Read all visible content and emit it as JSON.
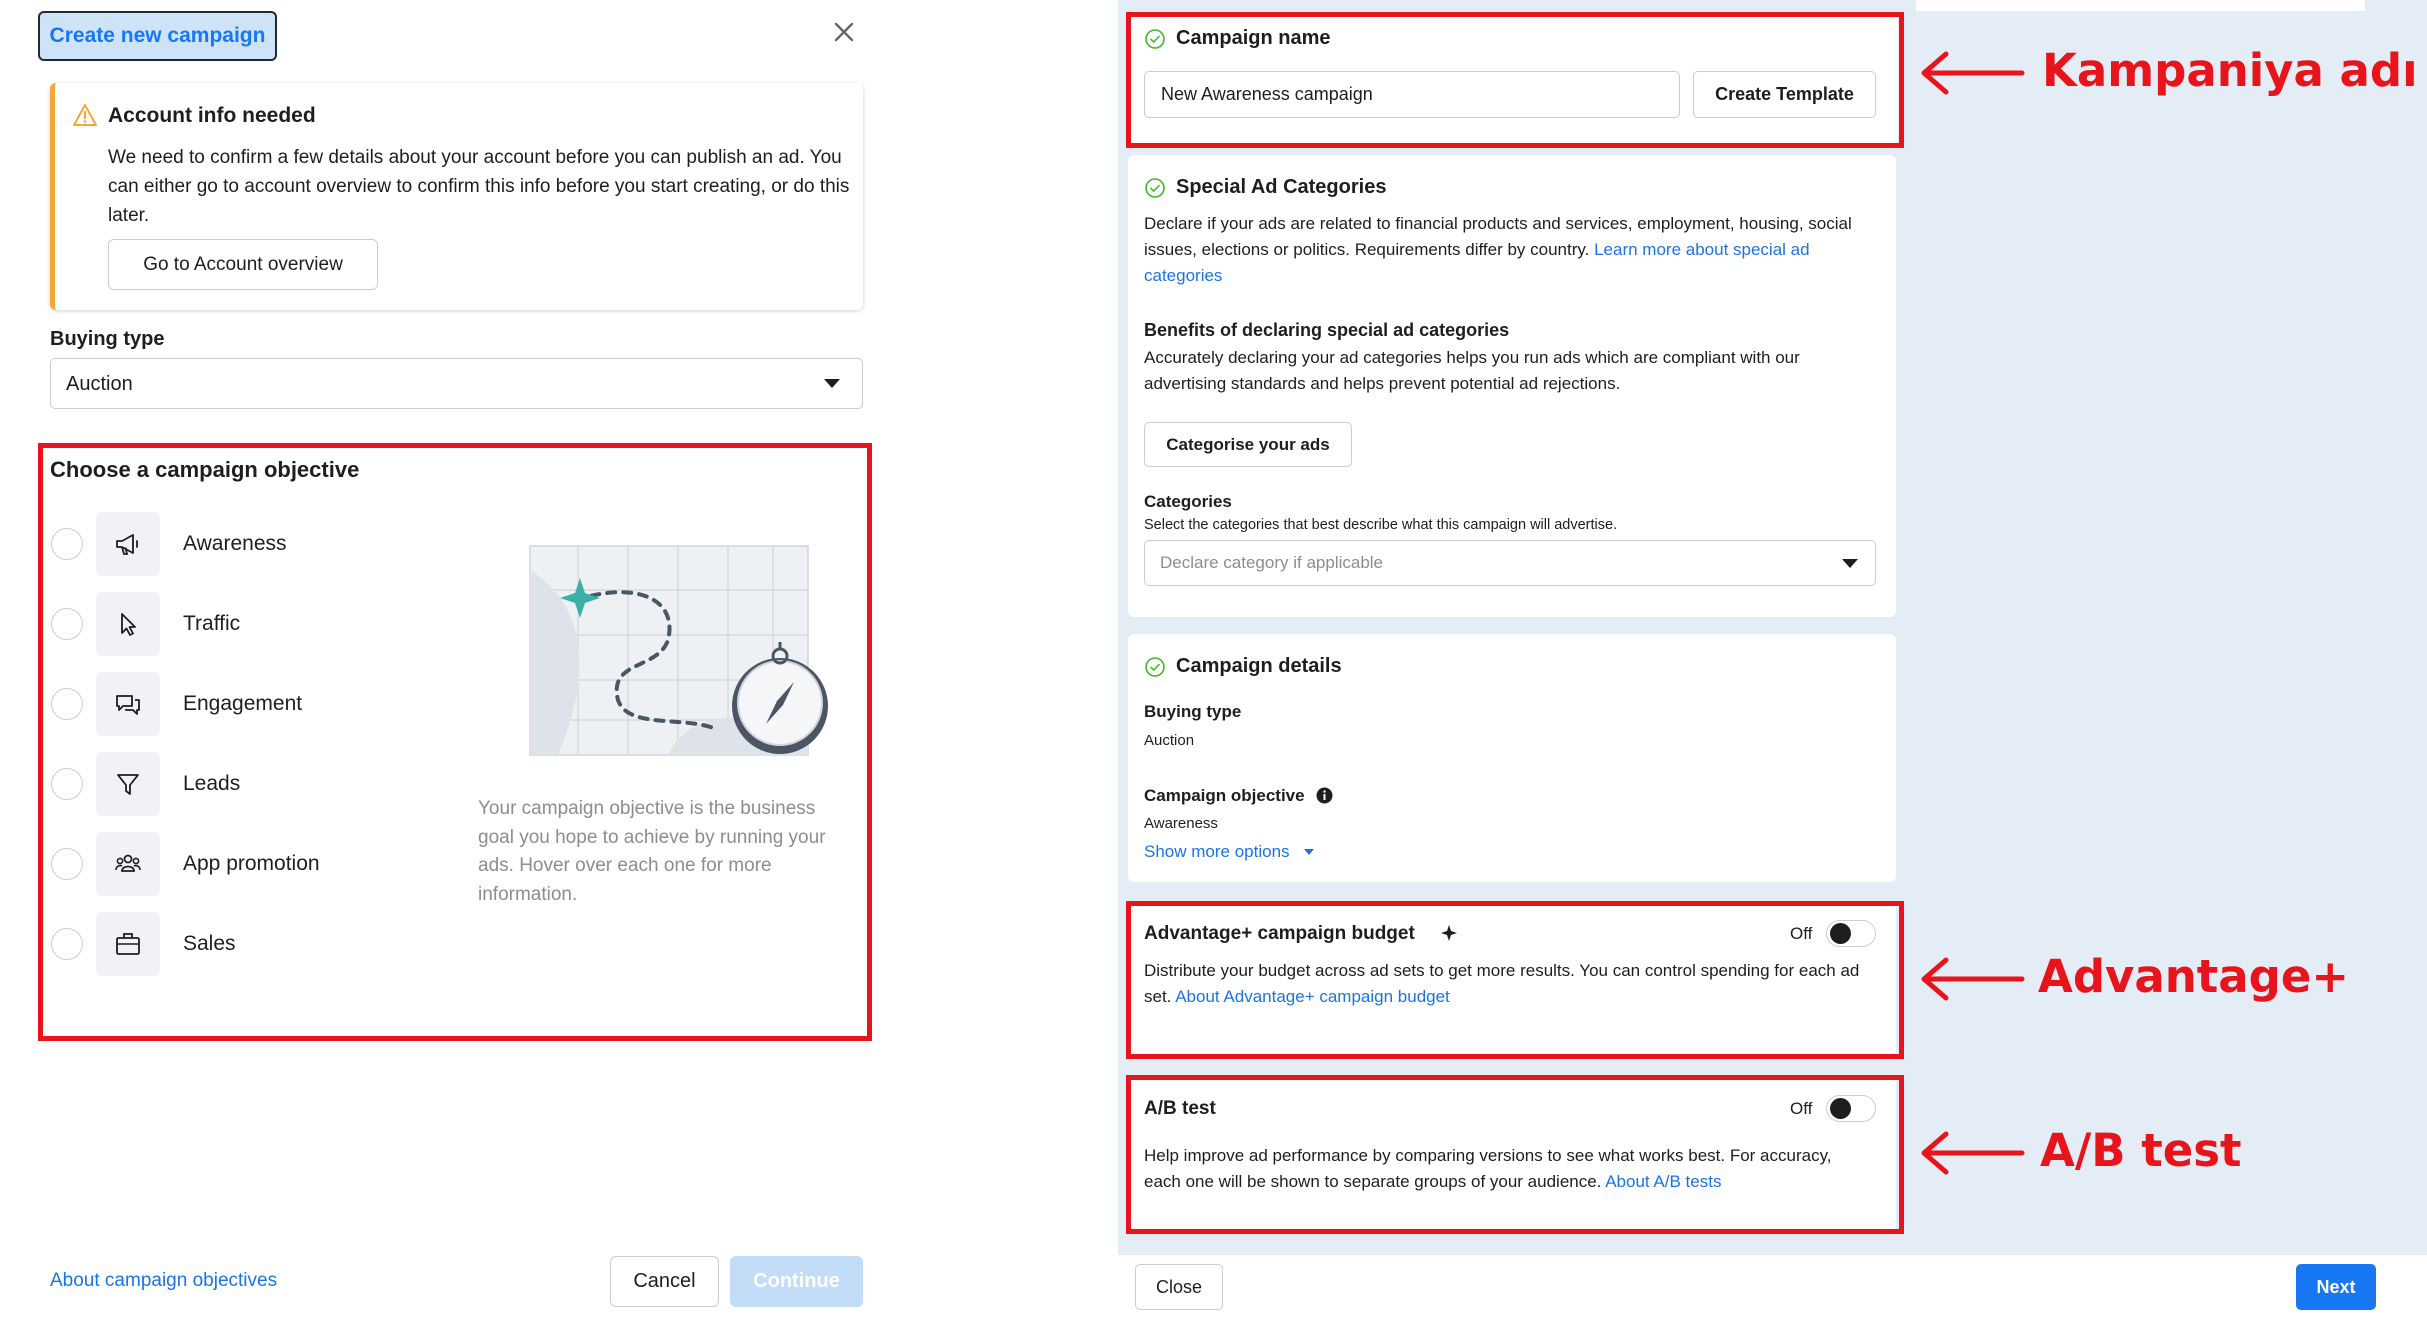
{
  "left": {
    "title_button": "Create new campaign",
    "alert": {
      "title": "Account info needed",
      "body": "We need to confirm a few details about your account before you can publish an ad. You can either go to account overview to confirm this info before you start creating, or do this later.",
      "button": "Go to Account overview"
    },
    "buying_type": {
      "label": "Buying type",
      "value": "Auction"
    },
    "objective": {
      "heading": "Choose a campaign objective",
      "options": [
        {
          "label": "Awareness",
          "icon": "megaphone-icon"
        },
        {
          "label": "Traffic",
          "icon": "cursor-icon"
        },
        {
          "label": "Engagement",
          "icon": "chat-bubbles-icon"
        },
        {
          "label": "Leads",
          "icon": "filter-icon"
        },
        {
          "label": "App promotion",
          "icon": "people-icon"
        },
        {
          "label": "Sales",
          "icon": "briefcase-icon"
        }
      ],
      "description": "Your campaign objective is the business goal you hope to achieve by running your ads. Hover over each one for more information."
    },
    "footer": {
      "about_link": "About campaign objectives",
      "cancel": "Cancel",
      "continue": "Continue"
    }
  },
  "right": {
    "campaign_name": {
      "title": "Campaign name",
      "value": "New Awareness campaign",
      "template_button": "Create Template"
    },
    "special": {
      "title": "Special Ad Categories",
      "body": "Declare if your ads are related to financial products and services, employment, housing, social issues, elections or politics. Requirements differ by country.",
      "link_1": "Learn more about special",
      "link_2": "ad categories",
      "benefits_title": "Benefits of declaring special ad categories",
      "benefits_body": "Accurately declaring your ad categories helps you run ads which are compliant with our advertising standards and helps prevent potential ad rejections.",
      "categorise_button": "Categorise your ads",
      "categories_label": "Categories",
      "categories_hint": "Select the categories that best describe what this campaign will advertise.",
      "categories_placeholder": "Declare category if applicable"
    },
    "details": {
      "title": "Campaign details",
      "buying_type_label": "Buying type",
      "buying_type_value": "Auction",
      "objective_label": "Campaign objective",
      "objective_value": "Awareness",
      "show_more": "Show more options"
    },
    "advantage": {
      "title": "Advantage+ campaign budget",
      "state": "Off",
      "body": "Distribute your budget across ad sets to get more results. You can control spending for each ad set.",
      "link": "About Advantage+ campaign budget"
    },
    "ab_test": {
      "title": "A/B test",
      "state": "Off",
      "body_1": "Help improve ad performance by comparing versions to see what works best. For accuracy,",
      "body_2": "each one will be shown to separate groups of your audience.",
      "link": "About A/B tests"
    },
    "footer": {
      "close": "Close",
      "next": "Next"
    }
  },
  "annotations": {
    "campaign_name": "Kampaniya adı",
    "advantage": "Advantage+",
    "ab_test": "A/B test"
  },
  "colors": {
    "accent": "#1877f2",
    "link": "#1b74e4",
    "annotation_red": "#e8141b",
    "alert_orange": "#f7a734",
    "right_background": "#e4ecf6"
  }
}
